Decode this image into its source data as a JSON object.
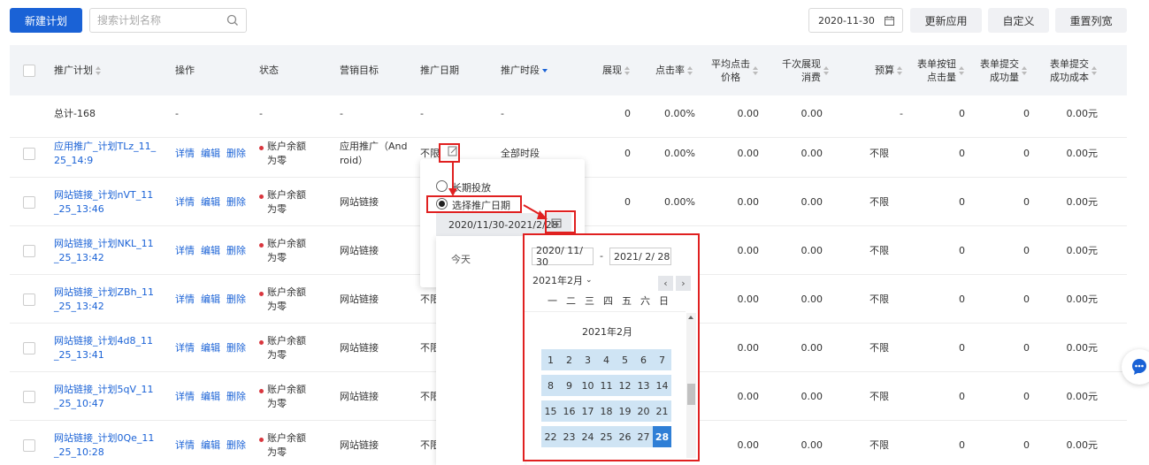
{
  "toolbar": {
    "new_plan": "新建计划",
    "search_placeholder": "搜索计划名称",
    "date": "2020-11-30",
    "update_apply": "更新应用",
    "customize": "自定义",
    "reset_columns": "重置列宽"
  },
  "columns": {
    "plan": "推广计划",
    "ops": "操作",
    "status": "状态",
    "target": "营销目标",
    "promo_date": "推广日期",
    "promo_time": "推广时段",
    "impressions": "展现",
    "ctr": "点击率",
    "avg_cpc_1": "平均点击",
    "avg_cpc_2": "价格",
    "cpm_1": "千次展现",
    "cpm_2": "消费",
    "budget": "预算",
    "form_click_1": "表单按钮",
    "form_click_2": "点击量",
    "form_submit_1": "表单提交",
    "form_submit_2": "成功量",
    "form_cost_1": "表单提交",
    "form_cost_2": "成功成本"
  },
  "total_row": {
    "label": "总计-168",
    "ops": "-",
    "status": "-",
    "target": "-",
    "date": "-",
    "time": "-",
    "impressions": "0",
    "ctr": "0.00%",
    "avg_cpc": "0.00",
    "cpm": "0.00",
    "budget": "-",
    "form_click": "0",
    "form_submit": "0",
    "form_cost": "0.00元"
  },
  "op_labels": {
    "detail": "详情",
    "edit": "编辑",
    "delete": "删除"
  },
  "rows": [
    {
      "name1": "应用推广_计划TLz_11_",
      "name2": "25_14:9",
      "status1": "账户余额",
      "status2": "为零",
      "target1": "应用推广（And",
      "target2": "roid）",
      "date": "不限",
      "time": "全部时段",
      "impressions": "0",
      "ctr": "0.00%",
      "avg_cpc": "0.00",
      "cpm": "0.00",
      "budget": "不限",
      "form_click": "0",
      "form_submit": "0",
      "form_cost": "0.00元"
    },
    {
      "name1": "网站链接_计划nVT_11",
      "name2": "_25_13:46",
      "status1": "账户余额",
      "status2": "为零",
      "target1": "网站链接",
      "target2": "",
      "date": "",
      "time": "",
      "impressions": "0",
      "ctr": "0.00%",
      "avg_cpc": "0.00",
      "cpm": "0.00",
      "budget": "不限",
      "form_click": "0",
      "form_submit": "0",
      "form_cost": "0.00元"
    },
    {
      "name1": "网站链接_计划NKL_11",
      "name2": "_25_13:42",
      "status1": "账户余额",
      "status2": "为零",
      "target1": "网站链接",
      "target2": "",
      "date": "",
      "time": "",
      "impressions": "",
      "ctr": "",
      "avg_cpc": "0.00",
      "cpm": "0.00",
      "budget": "不限",
      "form_click": "0",
      "form_submit": "0",
      "form_cost": "0.00元"
    },
    {
      "name1": "网站链接_计划ZBh_11",
      "name2": "_25_13:42",
      "status1": "账户余额",
      "status2": "为零",
      "target1": "网站链接",
      "target2": "",
      "date": "不限",
      "time": "",
      "impressions": "",
      "ctr": "",
      "avg_cpc": "0.00",
      "cpm": "0.00",
      "budget": "不限",
      "form_click": "0",
      "form_submit": "0",
      "form_cost": "0.00元"
    },
    {
      "name1": "网站链接_计划4d8_11",
      "name2": "_25_13:41",
      "status1": "账户余额",
      "status2": "为零",
      "target1": "网站链接",
      "target2": "",
      "date": "不限",
      "time": "",
      "impressions": "",
      "ctr": "",
      "avg_cpc": "0.00",
      "cpm": "0.00",
      "budget": "不限",
      "form_click": "0",
      "form_submit": "0",
      "form_cost": "0.00元"
    },
    {
      "name1": "网站链接_计划5qV_11",
      "name2": "_25_10:47",
      "status1": "账户余额",
      "status2": "为零",
      "target1": "网站链接",
      "target2": "",
      "date": "不限",
      "time": "",
      "impressions": "",
      "ctr": "",
      "avg_cpc": "0.00",
      "cpm": "0.00",
      "budget": "不限",
      "form_click": "0",
      "form_submit": "0",
      "form_cost": "0.00元"
    },
    {
      "name1": "网站链接_计划0Qe_11",
      "name2": "_25_10:28",
      "status1": "账户余额",
      "status2": "为零",
      "target1": "网站链接",
      "target2": "",
      "date": "不限",
      "time": "",
      "impressions": "",
      "ctr": "",
      "avg_cpc": "0.00",
      "cpm": "0.00",
      "budget": "不限",
      "form_click": "0",
      "form_submit": "0",
      "form_cost": "0.00元"
    }
  ],
  "popover": {
    "long_term": "长期投放",
    "select_date": "选择推广日期",
    "range": "2020/11/30-2021/2/28",
    "today": "今天"
  },
  "calendar": {
    "start": "2020/ 11/ 30",
    "sep": "-",
    "end": "2021/  2/ 28",
    "month_select": "2021年2月",
    "month_title": "2021年2月",
    "weekdays": [
      "一",
      "二",
      "三",
      "四",
      "五",
      "六",
      "日"
    ],
    "weeks": [
      [
        "1",
        "2",
        "3",
        "4",
        "5",
        "6",
        "7"
      ],
      [
        "8",
        "9",
        "10",
        "11",
        "12",
        "13",
        "14"
      ],
      [
        "15",
        "16",
        "17",
        "18",
        "19",
        "20",
        "21"
      ],
      [
        "22",
        "23",
        "24",
        "25",
        "26",
        "27",
        "28"
      ]
    ],
    "selected": "28"
  },
  "colors": {
    "primary": "#1a62d6",
    "annotation": "#e02020",
    "selected_day": "#2f7fd6",
    "day_bg": "#cfe4f4"
  }
}
